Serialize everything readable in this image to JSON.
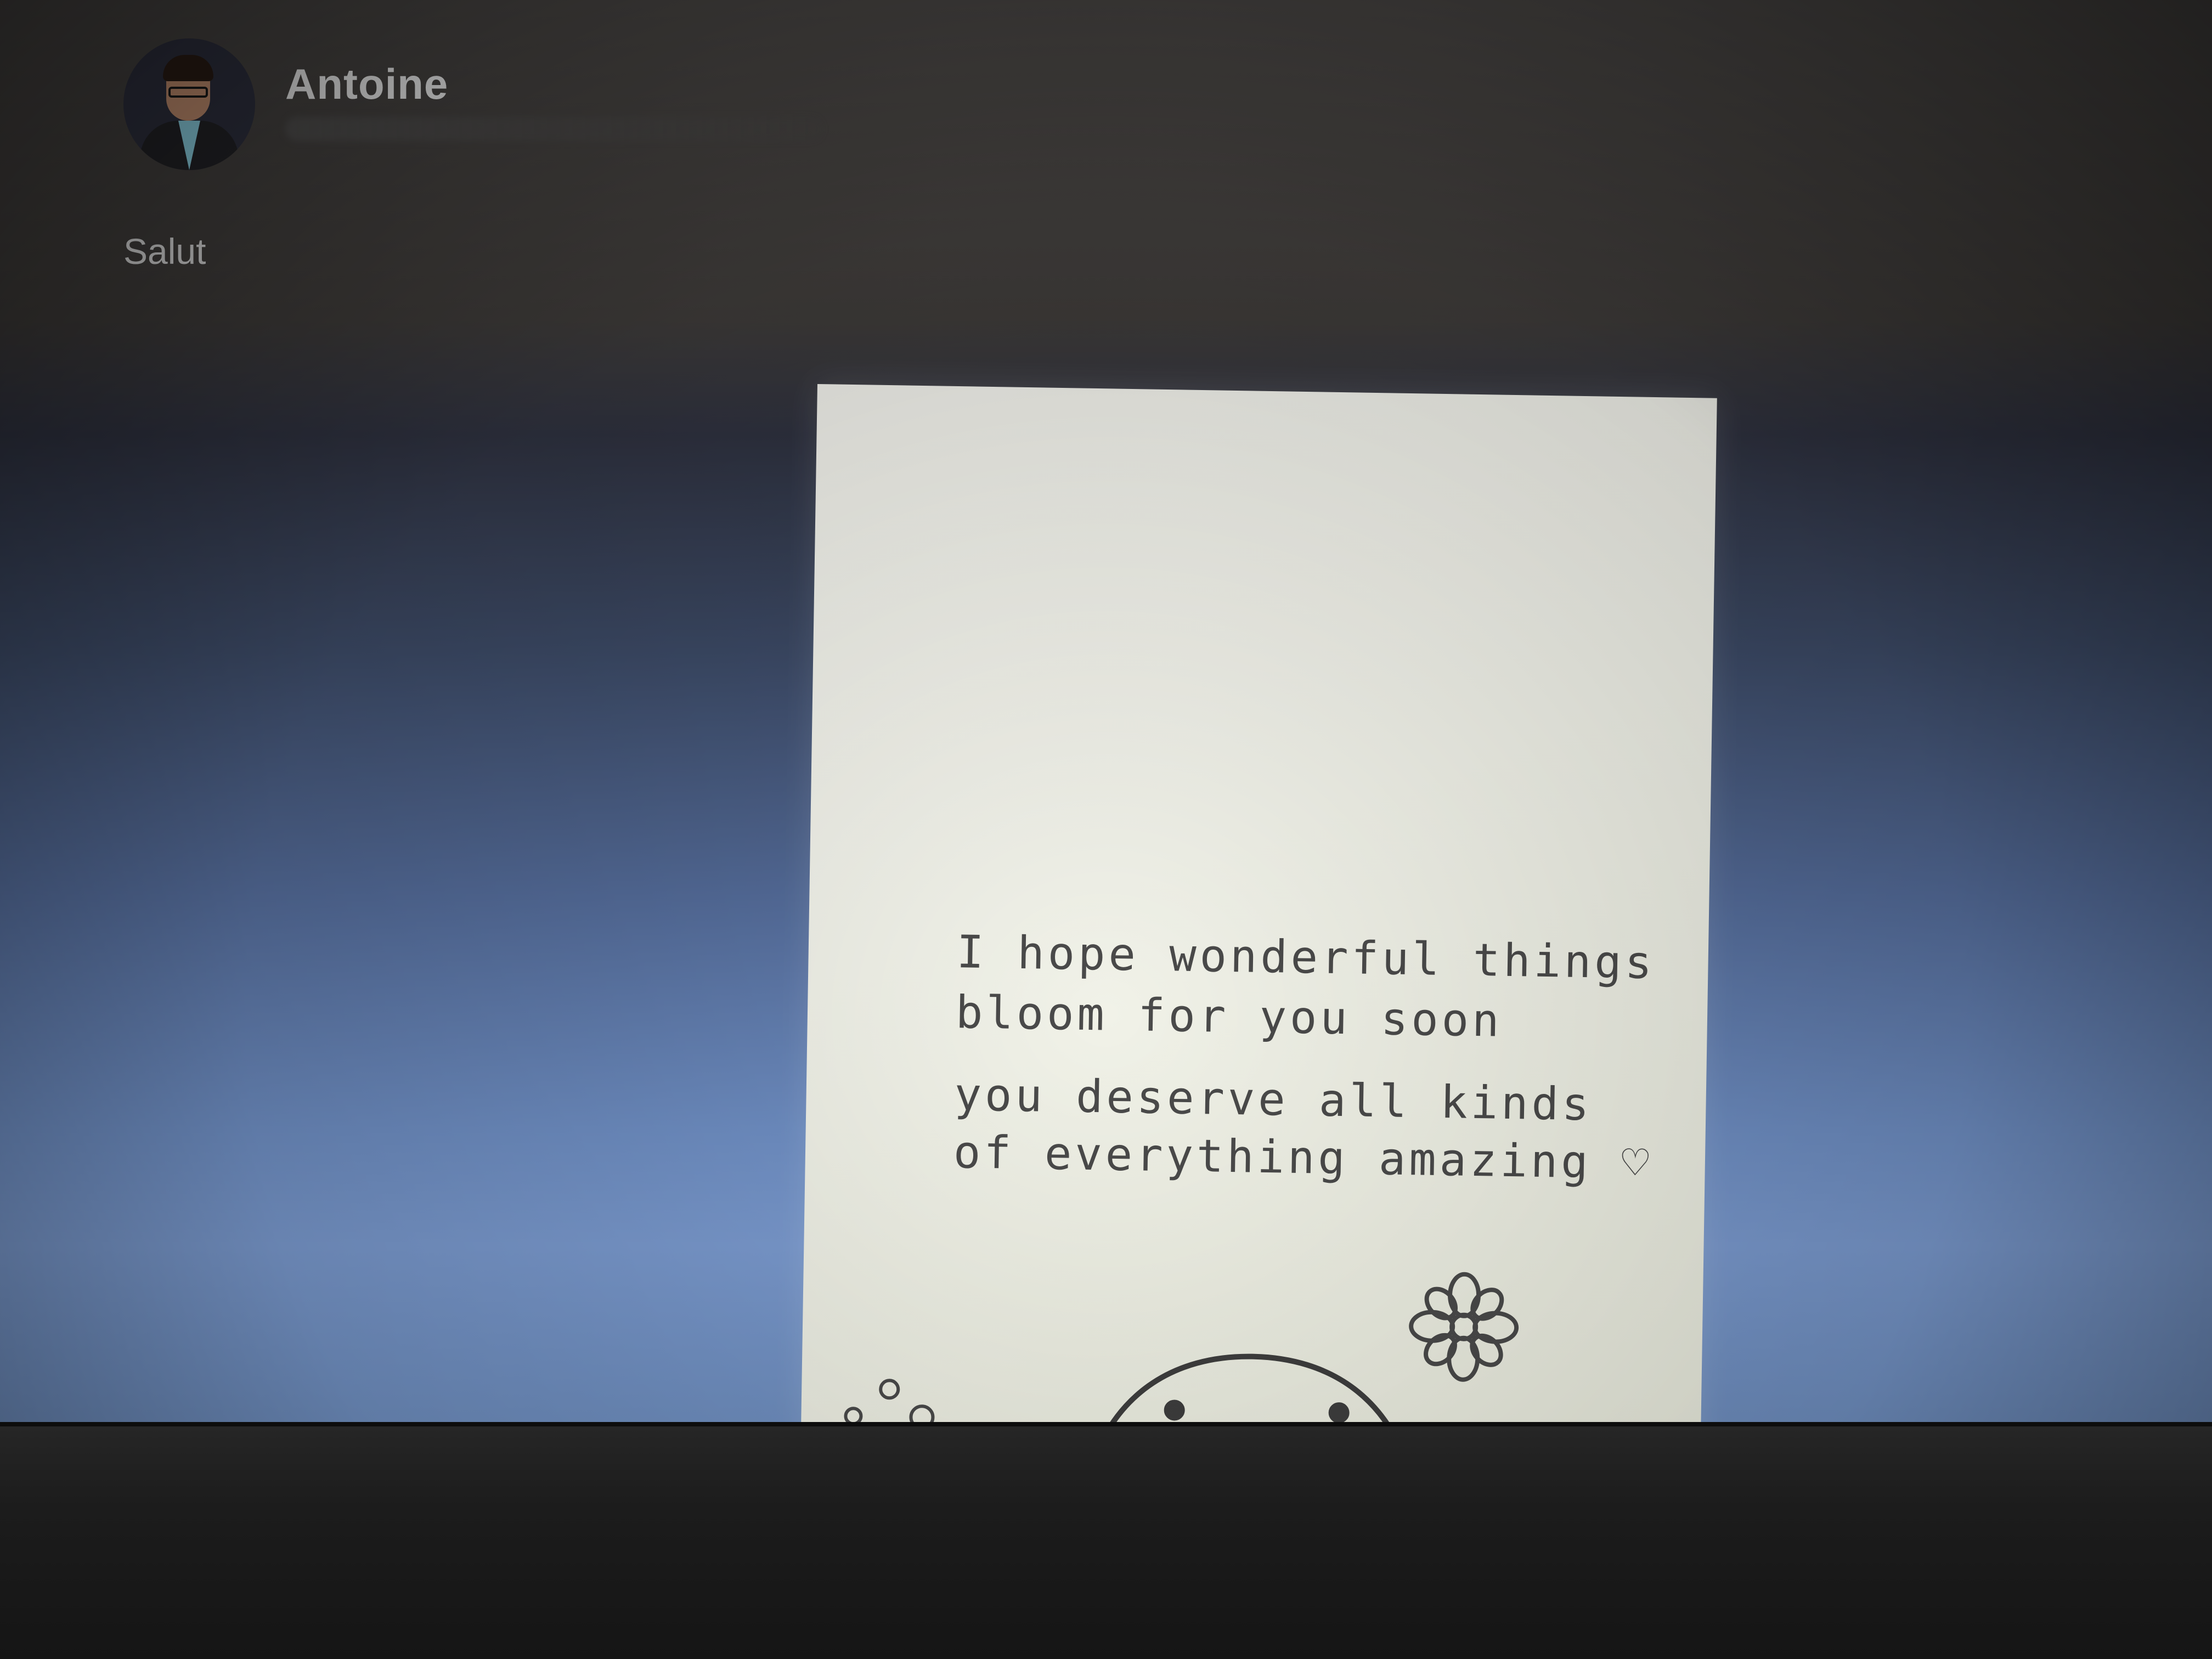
{
  "post": {
    "author_name": "Antoine",
    "author_avatar_icon": "avatar-icon",
    "text": "Salut"
  },
  "card": {
    "lines": [
      "I hope wonderful things",
      "bloom for you soon",
      "you deserve all kinds",
      "of everything amazing ♡"
    ],
    "doodles": [
      "flower-icon",
      "smiling-blob-icon",
      "bubbles-icon"
    ]
  },
  "colors": {
    "screen_top": "#4a4745",
    "screen_bottom": "#7b9bd0",
    "card_background": "#f2f3ea",
    "card_ink": "#4a4a4a",
    "author_text": "#f2f2f2"
  }
}
